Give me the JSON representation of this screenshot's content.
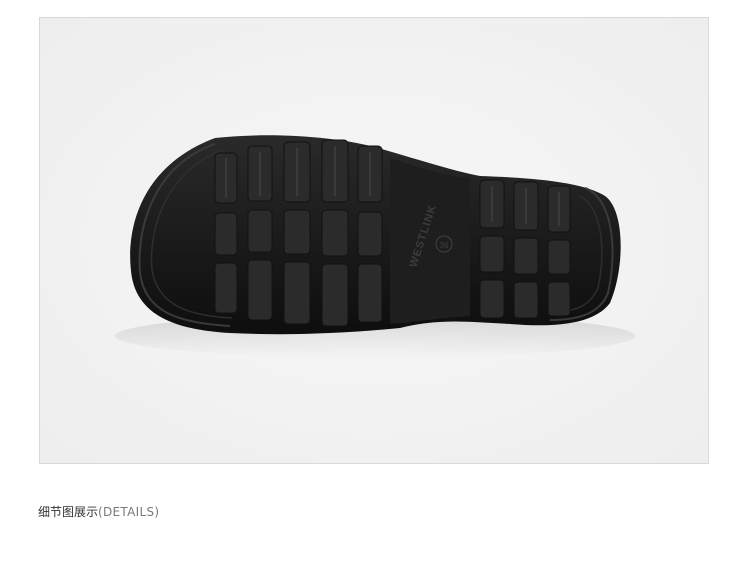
{
  "product_image": {
    "sole_brand_text": "WESTLINK",
    "sole_size_text": "36"
  },
  "caption": {
    "chinese": "细节图展示",
    "english": "(DETAILS)"
  },
  "colors": {
    "frame_border": "#d8d8d8",
    "photo_background": "#f2f2f2",
    "sole": "#1b1b1b",
    "caption_text": "#333333",
    "caption_english": "#7a7a7a"
  }
}
